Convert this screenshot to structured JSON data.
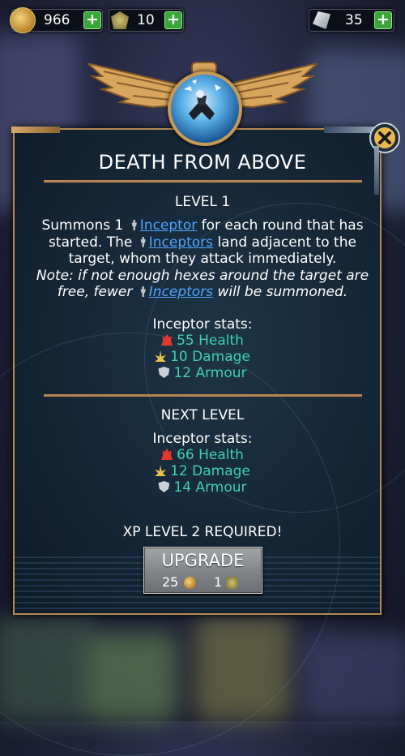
{
  "resources": [
    {
      "name": "coins",
      "value": "966"
    },
    {
      "name": "supplies",
      "value": "10"
    },
    {
      "name": "shards",
      "value": "35"
    }
  ],
  "ability": {
    "title": "DEATH FROM ABOVE",
    "level_label": "LEVEL 1",
    "description": {
      "p1": "Summons 1 ",
      "unit1": "Inceptor",
      "p2": " for each round that has started. The ",
      "unit2": "Inceptors",
      "p3": " land adjacent to the target, whom they attack immediately.",
      "note1": "Note: if not enough hexes around the target are free, fewer ",
      "unit3": "Inceptors",
      "note2": " will be summoned."
    },
    "current": {
      "stats_label": "Inceptor stats:",
      "health": "55 Health",
      "damage": "10 Damage",
      "armour": "12 Armour"
    },
    "next_level_label": "NEXT LEVEL",
    "next": {
      "stats_label": "Inceptor stats:",
      "health": "66 Health",
      "damage": "12 Damage",
      "armour": "14 Armour"
    },
    "requirement": "XP LEVEL 2 REQUIRED!",
    "upgrade": {
      "label": "UPGRADE",
      "cost_coins": "25",
      "cost_supplies": "1"
    }
  },
  "colors": {
    "accent_gold": "#b9834f",
    "stat_text": "#3ed0b4",
    "link": "#4fa3ff",
    "plus_green": "#3aa63a"
  }
}
